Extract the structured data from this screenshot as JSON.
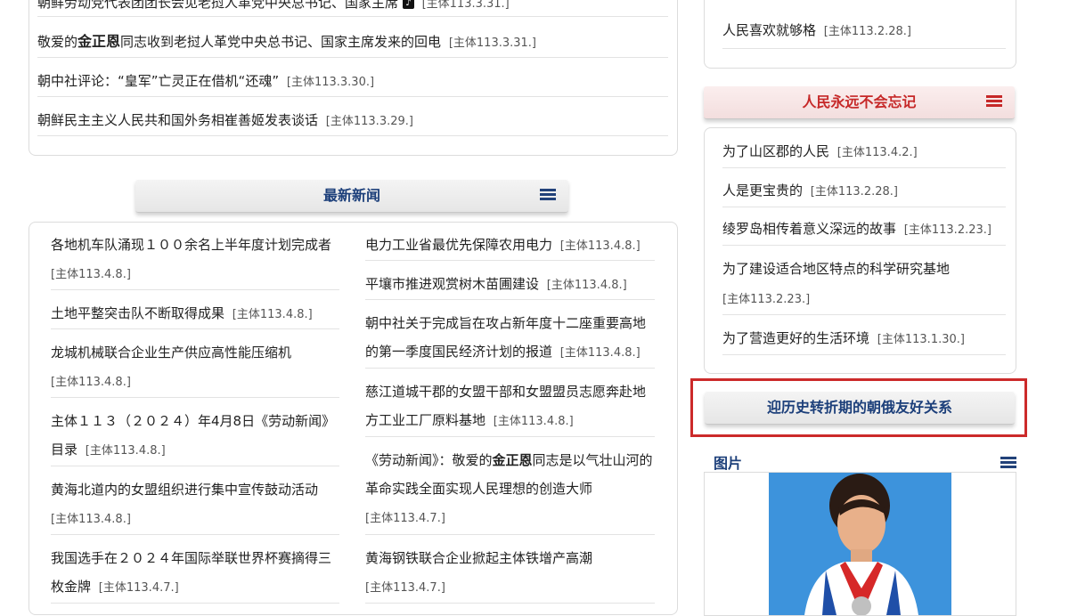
{
  "top_list": [
    {
      "title": "朝鲜劳动党代表团团长会见老挝人革党中央总书记、国家主席",
      "has_icon": true,
      "date": "[主体113.3.31.]"
    },
    {
      "title_pre": "敬爱的",
      "title_bold": "金正恩",
      "title_post": "同志收到老挝人革党中央总书记、国家主席发来的回电",
      "date": "[主体113.3.31.]"
    },
    {
      "title": "朝中社评论：“皇军”亡灵正在借机“还魂”",
      "date": "[主体113.3.30.]"
    },
    {
      "title": "朝鲜民主主义人民共和国外务相崔善姬发表谈话",
      "date": "[主体113.3.29.]"
    }
  ],
  "latest_news": {
    "heading": "最新新闻",
    "heading_color": "#1c3f7a",
    "left": [
      {
        "title": "各地机车队涌现１００余名上半年度计划完成者",
        "date": "[主体113.4.8.]"
      },
      {
        "title": "土地平整突击队不断取得成果",
        "date": "[主体113.4.8.]"
      },
      {
        "title": "龙城机械联合企业生产供应高性能压缩机",
        "date": "[主体113.4.8.]"
      },
      {
        "title": "主体１１３（２０２４）年4月8日《劳动新闻》目录",
        "date": "[主体113.4.8.]"
      },
      {
        "title": "黄海北道内的女盟组织进行集中宣传鼓动活动",
        "date": "[主体113.4.8.]"
      },
      {
        "title": "我国选手在２０２４年国际举联世界杯赛摘得三枚金牌",
        "date": "[主体113.4.7.]"
      }
    ],
    "right": [
      {
        "title": "电力工业省最优先保障农用电力",
        "date": "[主体113.4.8.]"
      },
      {
        "title": "平壤市推进观赏树木苗圃建设",
        "date": "[主体113.4.8.]"
      },
      {
        "title": "朝中社关于完成旨在攻占新年度十二座重要高地的第一季度国民经济计划的报道",
        "date": "[主体113.4.8.]"
      },
      {
        "title": "慈江道城干郡的女盟干部和女盟盟员志愿奔赴地方工业工厂原料基地",
        "date": "[主体113.4.8.]"
      },
      {
        "title_pre": "《劳动新闻》：敬爱的",
        "title_bold": "金正恩",
        "title_post": "同志是以气壮山河的革命实践全面实现人民理想的创造大师",
        "date": "[主体113.4.7.]"
      },
      {
        "title": "黄海钢铁联合企业掀起主体铁增产高潮",
        "date": "[主体113.4.7.]"
      }
    ]
  },
  "right_top": [
    {
      "title": "人民喜欢就够格",
      "date": "[主体113.2.28.]"
    }
  ],
  "never_forget": {
    "heading": "人民永远不会忘记",
    "heading_color": "#c62828",
    "items": [
      {
        "title": "为了山区郡的人民",
        "date": "[主体113.4.2.]"
      },
      {
        "title": "人是更宝贵的",
        "date": "[主体113.2.28.]"
      },
      {
        "title": "绫罗岛相传着意义深远的故事",
        "date": "[主体113.2.23.]"
      },
      {
        "title": "为了建设适合地区特点的科学研究基地",
        "date": "[主体113.2.23.]"
      },
      {
        "title": "为了营造更好的生活环境",
        "date": "[主体113.1.30.]"
      }
    ]
  },
  "feature_banner": {
    "label": "迎历史转折期的朝俄友好关系",
    "color": "#1c3f7a"
  },
  "pictures": {
    "heading": "图片"
  },
  "icons": {
    "list": "list-icon",
    "tiktok": "tiktok-icon"
  }
}
